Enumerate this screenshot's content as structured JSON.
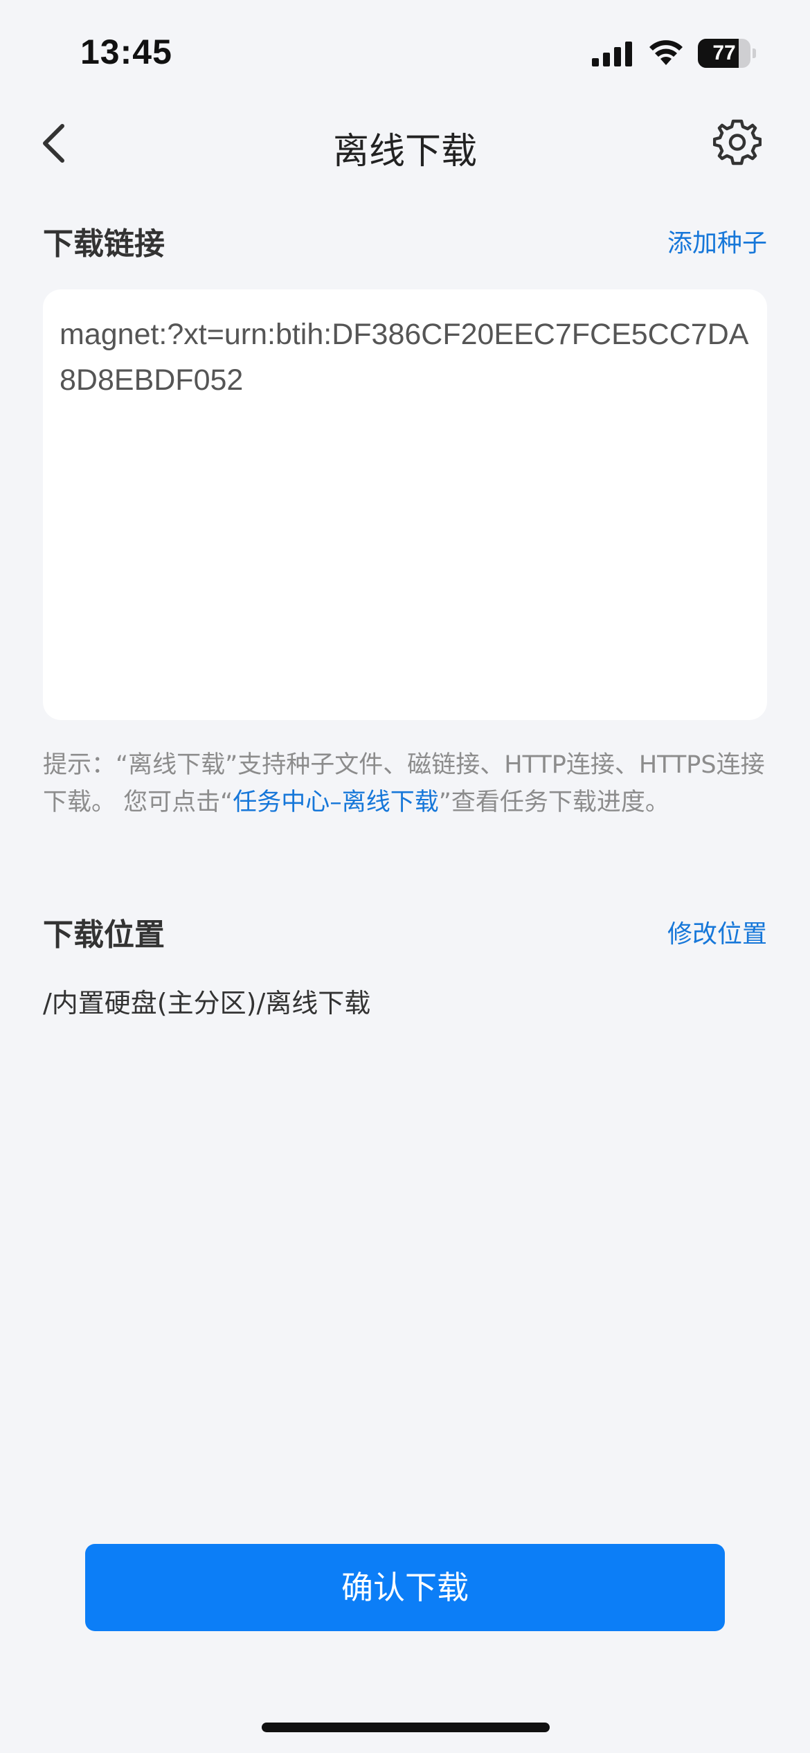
{
  "status_bar": {
    "time": "13:45",
    "battery_level": "77",
    "battery_fraction": 0.77,
    "icons": [
      "signal-icon",
      "wifi-icon",
      "battery-icon"
    ]
  },
  "nav": {
    "title": "离线下载",
    "back_icon": "chevron-left-icon",
    "settings_icon": "gear-icon"
  },
  "download_link": {
    "title": "下载链接",
    "action_label": "添加种子",
    "value": "magnet:?xt=urn:btih:DF386CF20EEC7FCE5CC7DA8D8EBDF052"
  },
  "hint": {
    "prefix": "提示：“离线下载”支持种子文件、磁链接、HTTP连接、HTTPS连接下载。 您可点击“",
    "link_text": "任务中心–离线下载",
    "suffix": "”查看任务下载进度。"
  },
  "download_location": {
    "title": "下载位置",
    "action_label": "修改位置",
    "path": "/内置硬盘(主分区)/离线下载"
  },
  "confirm_label": "确认下载",
  "colors": {
    "accent": "#0c7ef7",
    "link": "#1677d9",
    "background": "#f4f5f8"
  }
}
